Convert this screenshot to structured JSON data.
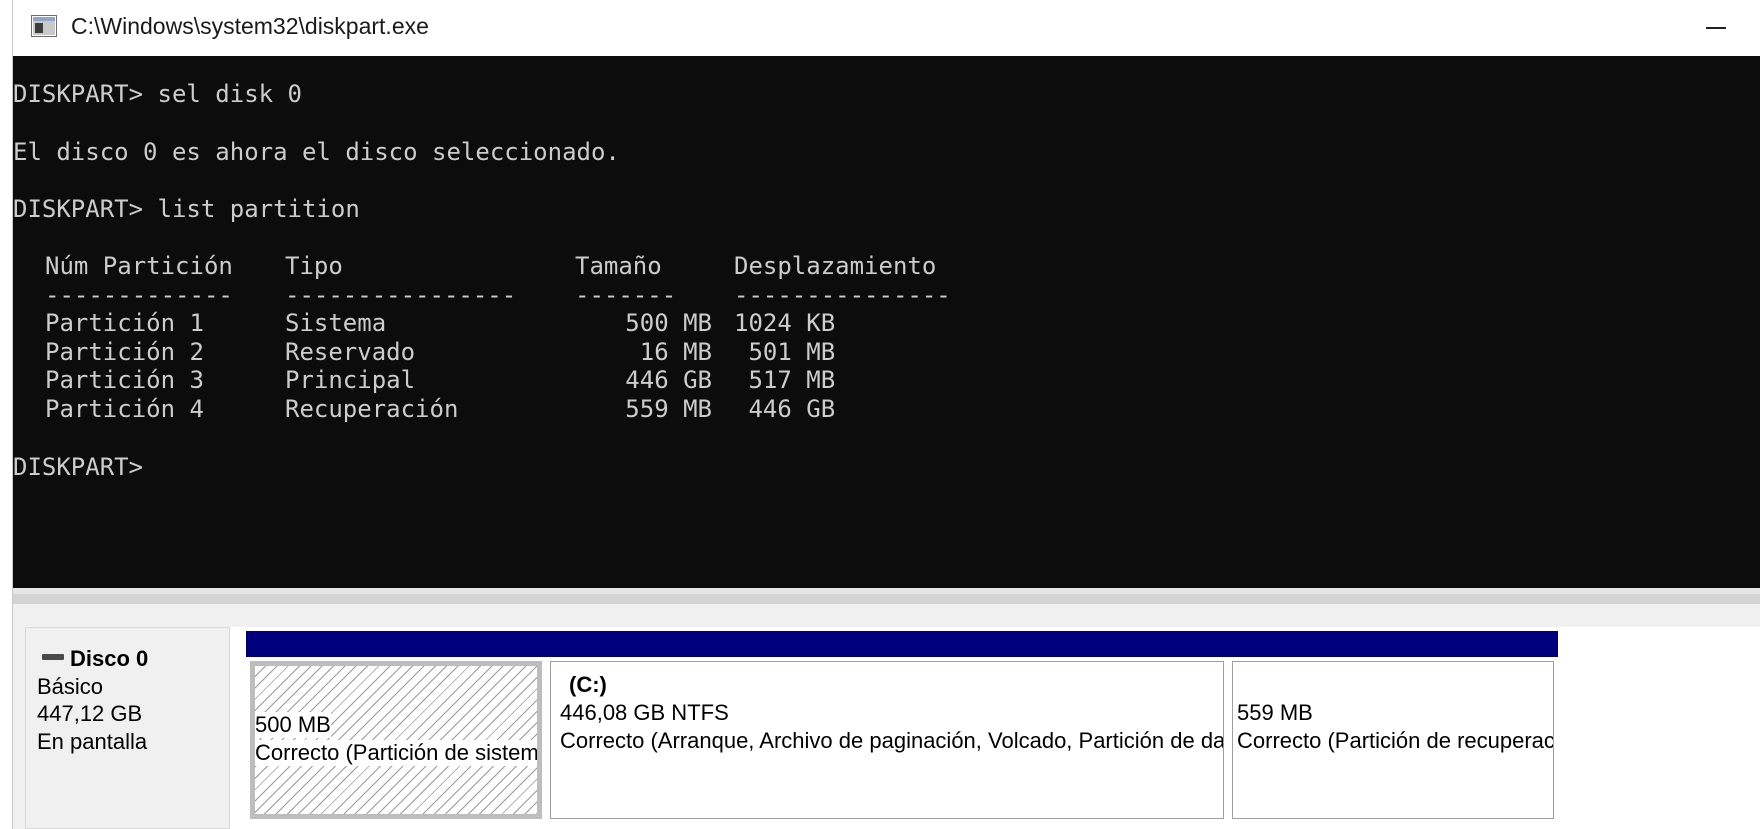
{
  "window": {
    "title": "C:\\Windows\\system32\\diskpart.exe",
    "icon": "console-window-icon",
    "minimize_icon": "minimize-icon"
  },
  "console": {
    "cmd1": "DISKPART> sel disk 0",
    "out1": "El disco 0 es ahora el disco seleccionado.",
    "cmd2": "DISKPART> list partition",
    "table": {
      "headers": [
        "Núm Partición",
        "Tipo",
        "Tamaño",
        "Desplazamiento"
      ],
      "separators": [
        "-------------",
        "----------------",
        "-------",
        "---------------"
      ],
      "rows": [
        [
          "Partición 1",
          "Sistema",
          "500 MB",
          "1024 KB"
        ],
        [
          "Partición 2",
          "Reservado",
          "16 MB",
          " 501 MB"
        ],
        [
          "Partición 3",
          "Principal",
          "446 GB",
          " 517 MB"
        ],
        [
          "Partición 4",
          "Recuperación",
          "559 MB",
          " 446 GB"
        ]
      ]
    },
    "prompt": "DISKPART>",
    "colors": {
      "background": "#0c0c0c",
      "text": "#cccccc"
    }
  },
  "disk": {
    "name": "Disco 0",
    "type": "Básico",
    "size": "447,12 GB",
    "status": "En pantalla",
    "icon": "disk-drive-icon",
    "partitions": [
      {
        "label": "",
        "size": "500 MB",
        "status": "Correcto (Partición de sistema E",
        "selected": true
      },
      {
        "label": "(C:)",
        "size": "446,08 GB NTFS",
        "status": "Correcto (Arranque, Archivo de paginación, Volcado, Partición de dat"
      },
      {
        "label": "",
        "size": "559 MB",
        "status": "Correcto (Partición de recuperac"
      }
    ],
    "colors": {
      "partition_header": "#00007f"
    }
  }
}
